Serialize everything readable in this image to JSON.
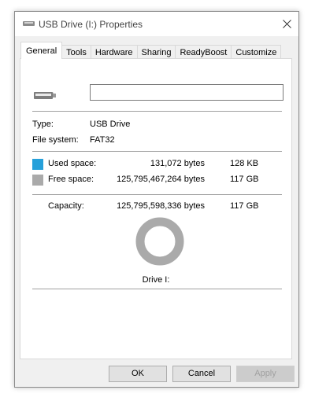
{
  "window": {
    "title": "USB Drive (I:) Properties"
  },
  "tabs": [
    {
      "label": "General",
      "active": true
    },
    {
      "label": "Tools"
    },
    {
      "label": "Hardware"
    },
    {
      "label": "Sharing"
    },
    {
      "label": "ReadyBoost"
    },
    {
      "label": "Customize"
    }
  ],
  "general": {
    "drive_name_value": "",
    "type_label": "Type:",
    "type_value": "USB Drive",
    "fs_label": "File system:",
    "fs_value": "FAT32",
    "used_label": "Used space:",
    "used_bytes": "131,072 bytes",
    "used_size": "128 KB",
    "free_label": "Free space:",
    "free_bytes": "125,795,467,264 bytes",
    "free_size": "117 GB",
    "capacity_label": "Capacity:",
    "capacity_bytes": "125,795,598,336 bytes",
    "capacity_size": "117 GB",
    "drive_label": "Drive I:",
    "used_fraction": 1e-06,
    "used_color": "#26a0da",
    "free_color": "#aaaaaa"
  },
  "buttons": {
    "ok": "OK",
    "cancel": "Cancel",
    "apply": "Apply"
  }
}
